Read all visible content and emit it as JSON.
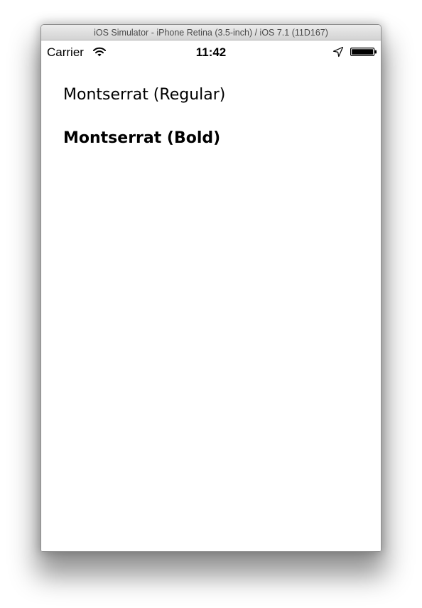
{
  "window": {
    "title": "iOS Simulator - iPhone Retina (3.5-inch) / iOS 7.1 (11D167)"
  },
  "status_bar": {
    "carrier": "Carrier",
    "time": "11:42",
    "icons": [
      "wifi-icon",
      "location-arrow-icon",
      "battery-icon"
    ]
  },
  "content": {
    "labels": [
      "Montserrat (Regular)",
      "Montserrat (Bold)"
    ]
  }
}
